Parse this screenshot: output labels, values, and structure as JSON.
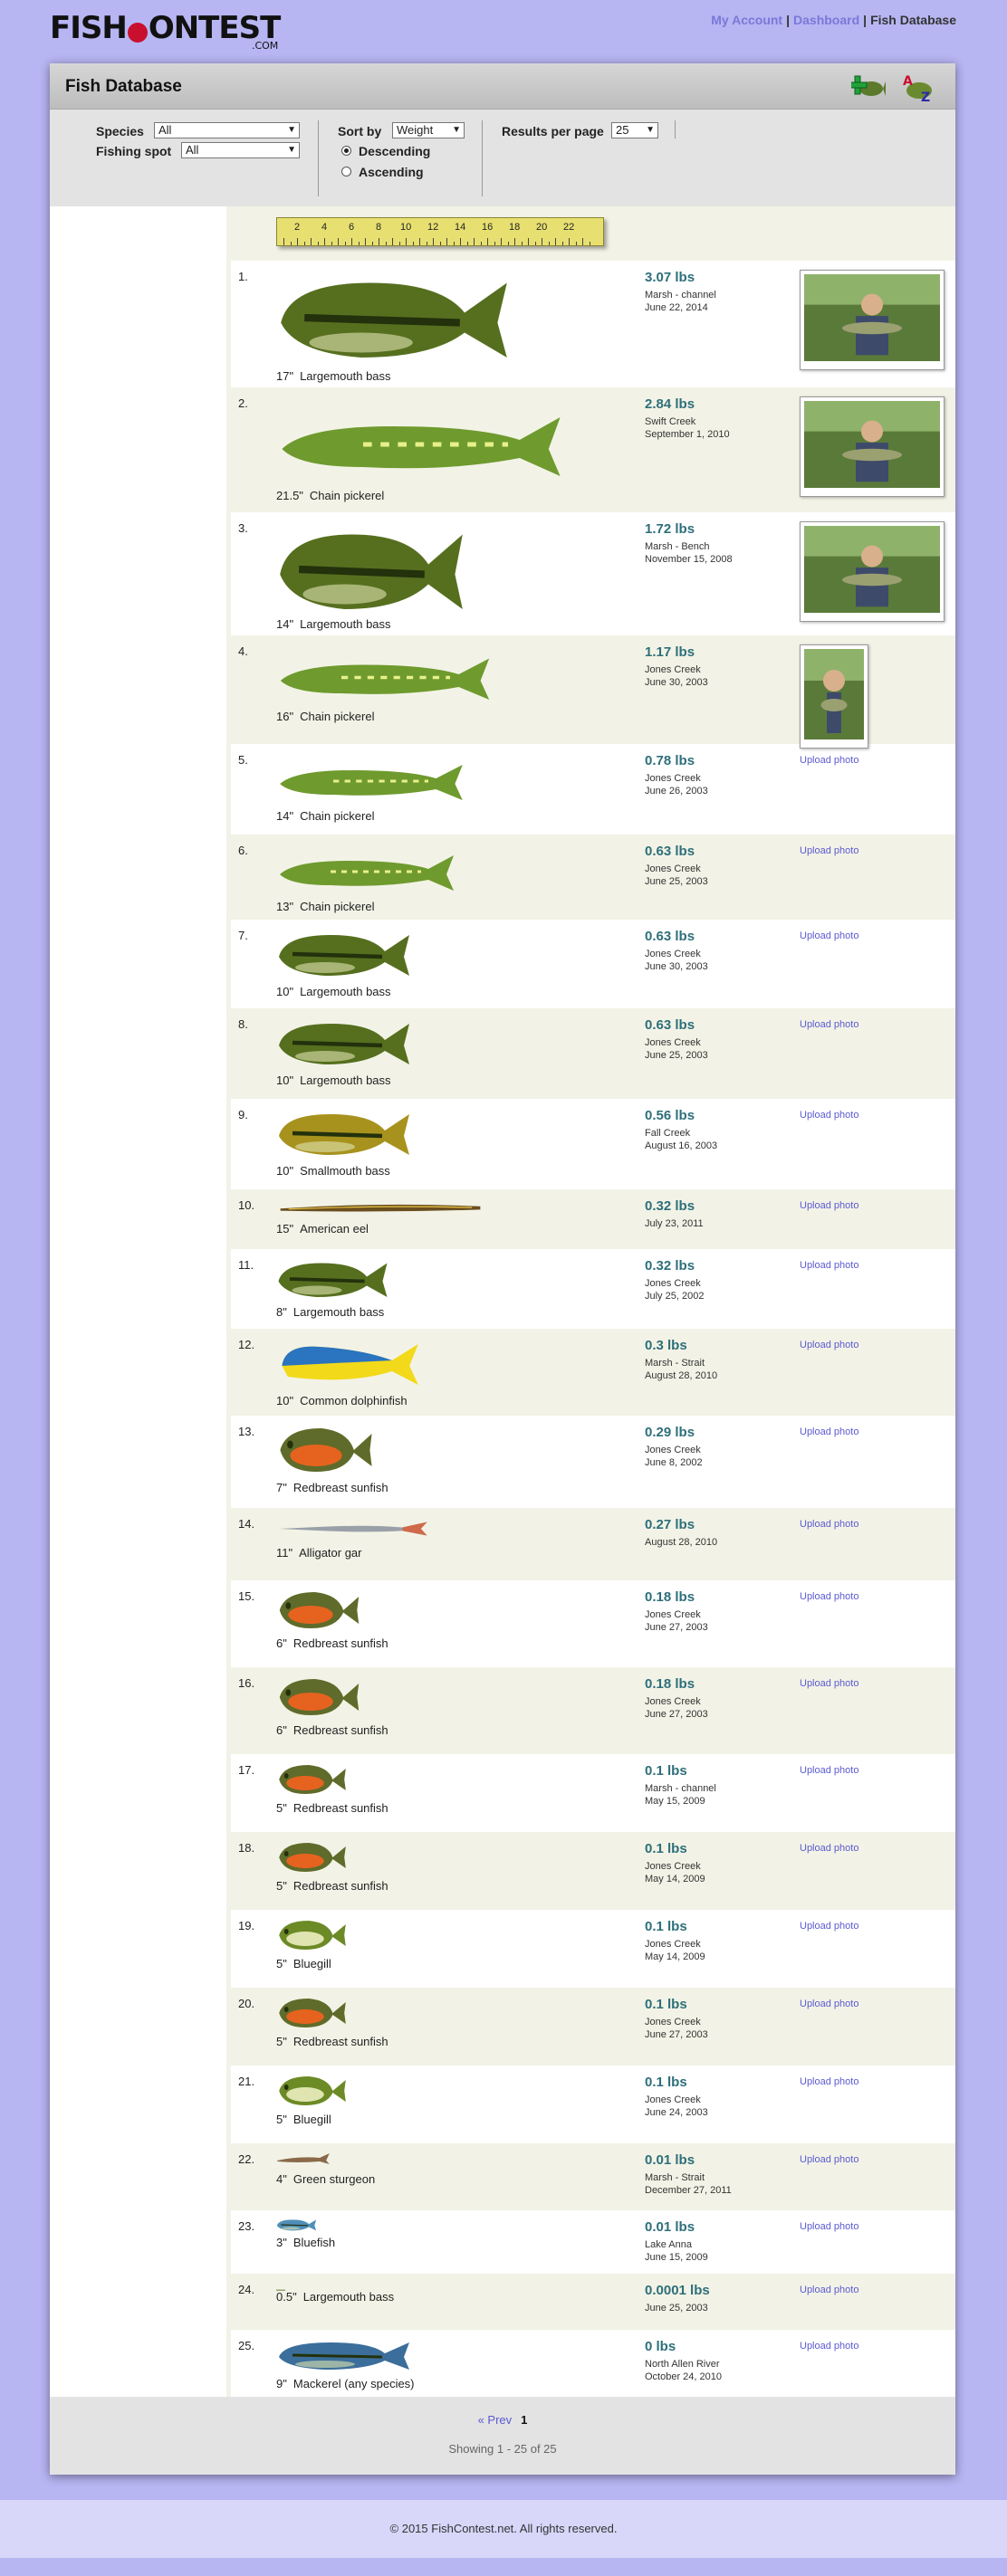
{
  "brand": {
    "name": "FishContest",
    "name_left": "FISH",
    "name_right": "ONTEST",
    "bobber_letter": "C",
    "suffix": ".COM"
  },
  "nav": {
    "my_account": "My Account",
    "dashboard": "Dashboard",
    "current": "Fish Database",
    "separator": "|"
  },
  "panel": {
    "title": "Fish Database",
    "icons": [
      "add-fish-icon",
      "sort-az-icon"
    ]
  },
  "filters": {
    "species_label": "Species",
    "species_value": "All",
    "spot_label": "Fishing spot",
    "spot_value": "All",
    "sort_label": "Sort by",
    "sort_value": "Weight",
    "order_options": [
      "Descending",
      "Ascending"
    ],
    "order_selected": "Descending",
    "rpp_label": "Results per page",
    "rpp_value": "25"
  },
  "ruler_ticks": [
    "2",
    "4",
    "6",
    "8",
    "10",
    "12",
    "14",
    "16",
    "18",
    "20",
    "22"
  ],
  "upload_label": "Upload photo",
  "rows": [
    {
      "rank": "1.",
      "length": "17\"",
      "species": "Largemouth bass",
      "weight": "3.07 lbs",
      "spot": "Marsh - channel",
      "date": "June 22, 2014",
      "photo": true,
      "kind": "bass",
      "color": "#566f1f"
    },
    {
      "rank": "2.",
      "length": "21.5\"",
      "species": "Chain pickerel",
      "weight": "2.84 lbs",
      "spot": "Swift Creek",
      "date": "September 1, 2010",
      "photo": true,
      "kind": "pike",
      "color": "#6f9a2e"
    },
    {
      "rank": "3.",
      "length": "14\"",
      "species": "Largemouth bass",
      "weight": "1.72 lbs",
      "spot": "Marsh - Bench",
      "date": "November 15, 2008",
      "photo": true,
      "kind": "bass",
      "color": "#566f1f"
    },
    {
      "rank": "4.",
      "length": "16\"",
      "species": "Chain pickerel",
      "weight": "1.17 lbs",
      "spot": "Jones Creek",
      "date": "June 30, 2003",
      "photo": true,
      "kind": "pike",
      "color": "#6f9a2e"
    },
    {
      "rank": "5.",
      "length": "14\"",
      "species": "Chain pickerel",
      "weight": "0.78 lbs",
      "spot": "Jones Creek",
      "date": "June 26, 2003",
      "photo": false,
      "kind": "pike",
      "color": "#6f9a2e"
    },
    {
      "rank": "6.",
      "length": "13\"",
      "species": "Chain pickerel",
      "weight": "0.63 lbs",
      "spot": "Jones Creek",
      "date": "June 25, 2003",
      "photo": false,
      "kind": "pike",
      "color": "#6f9a2e"
    },
    {
      "rank": "7.",
      "length": "10\"",
      "species": "Largemouth bass",
      "weight": "0.63 lbs",
      "spot": "Jones Creek",
      "date": "June 30, 2003",
      "photo": false,
      "kind": "bass",
      "color": "#566f1f"
    },
    {
      "rank": "8.",
      "length": "10\"",
      "species": "Largemouth bass",
      "weight": "0.63 lbs",
      "spot": "Jones Creek",
      "date": "June 25, 2003",
      "photo": false,
      "kind": "bass",
      "color": "#566f1f"
    },
    {
      "rank": "9.",
      "length": "10\"",
      "species": "Smallmouth bass",
      "weight": "0.56 lbs",
      "spot": "Fall Creek",
      "date": "August 16, 2003",
      "photo": false,
      "kind": "bass",
      "color": "#a8921e"
    },
    {
      "rank": "10.",
      "length": "15\"",
      "species": "American eel",
      "weight": "0.32 lbs",
      "spot": "",
      "date": "July 23, 2011",
      "photo": false,
      "kind": "eel",
      "color": "#6b4e1e"
    },
    {
      "rank": "11.",
      "length": "8\"",
      "species": "Largemouth bass",
      "weight": "0.32 lbs",
      "spot": "Jones Creek",
      "date": "July 25, 2002",
      "photo": false,
      "kind": "bass",
      "color": "#566f1f"
    },
    {
      "rank": "12.",
      "length": "10\"",
      "species": "Common dolphinfish",
      "weight": "0.3 lbs",
      "spot": "Marsh - Strait",
      "date": "August 28, 2010",
      "photo": false,
      "kind": "dolphin",
      "color": "#2a74c0"
    },
    {
      "rank": "13.",
      "length": "7\"",
      "species": "Redbreast sunfish",
      "weight": "0.29 lbs",
      "spot": "Jones Creek",
      "date": "June 8, 2002",
      "photo": false,
      "kind": "sunfish",
      "color": "#5f6b2a"
    },
    {
      "rank": "14.",
      "length": "11\"",
      "species": "Alligator gar",
      "weight": "0.27 lbs",
      "spot": "",
      "date": "August 28, 2010",
      "photo": false,
      "kind": "gar",
      "color": "#9aa0a8"
    },
    {
      "rank": "15.",
      "length": "6\"",
      "species": "Redbreast sunfish",
      "weight": "0.18 lbs",
      "spot": "Jones Creek",
      "date": "June 27, 2003",
      "photo": false,
      "kind": "sunfish",
      "color": "#5f6b2a"
    },
    {
      "rank": "16.",
      "length": "6\"",
      "species": "Redbreast sunfish",
      "weight": "0.18 lbs",
      "spot": "Jones Creek",
      "date": "June 27, 2003",
      "photo": false,
      "kind": "sunfish",
      "color": "#5f6b2a"
    },
    {
      "rank": "17.",
      "length": "5\"",
      "species": "Redbreast sunfish",
      "weight": "0.1 lbs",
      "spot": "Marsh - channel",
      "date": "May 15, 2009",
      "photo": false,
      "kind": "sunfish",
      "color": "#5f6b2a"
    },
    {
      "rank": "18.",
      "length": "5\"",
      "species": "Redbreast sunfish",
      "weight": "0.1 lbs",
      "spot": "Jones Creek",
      "date": "May 14, 2009",
      "photo": false,
      "kind": "sunfish",
      "color": "#5f6b2a"
    },
    {
      "rank": "19.",
      "length": "5\"",
      "species": "Bluegill",
      "weight": "0.1 lbs",
      "spot": "Jones Creek",
      "date": "May 14, 2009",
      "photo": false,
      "kind": "bluegill",
      "color": "#6c8a25"
    },
    {
      "rank": "20.",
      "length": "5\"",
      "species": "Redbreast sunfish",
      "weight": "0.1 lbs",
      "spot": "Jones Creek",
      "date": "June 27, 2003",
      "photo": false,
      "kind": "sunfish",
      "color": "#5f6b2a"
    },
    {
      "rank": "21.",
      "length": "5\"",
      "species": "Bluegill",
      "weight": "0.1 lbs",
      "spot": "Jones Creek",
      "date": "June 24, 2003",
      "photo": false,
      "kind": "bluegill",
      "color": "#6c8a25"
    },
    {
      "rank": "22.",
      "length": "4\"",
      "species": "Green sturgeon",
      "weight": "0.01 lbs",
      "spot": "Marsh - Strait",
      "date": "December 27, 2011",
      "photo": false,
      "kind": "sturgeon",
      "color": "#8a6a4a"
    },
    {
      "rank": "23.",
      "length": "3\"",
      "species": "Bluefish",
      "weight": "0.01 lbs",
      "spot": "Lake Anna",
      "date": "June 15, 2009",
      "photo": false,
      "kind": "bluefish",
      "color": "#4f8fb8"
    },
    {
      "rank": "24.",
      "length": "0.5\"",
      "species": "Largemouth bass",
      "weight": "0.0001 lbs",
      "spot": "",
      "date": "June 25, 2003",
      "photo": false,
      "kind": "tiny",
      "color": "#566f1f"
    },
    {
      "rank": "25.",
      "length": "9\"",
      "species": "Mackerel (any species)",
      "weight": "0 lbs",
      "spot": "North Allen River",
      "date": "October 24, 2010",
      "photo": false,
      "kind": "mackerel",
      "color": "#3b6e9a"
    }
  ],
  "pager": {
    "prev": "« Prev",
    "current_page": "1",
    "showing": "Showing 1 - 25 of 25"
  },
  "footer": {
    "text": "© 2015 FishContest.net. All rights reserved."
  }
}
